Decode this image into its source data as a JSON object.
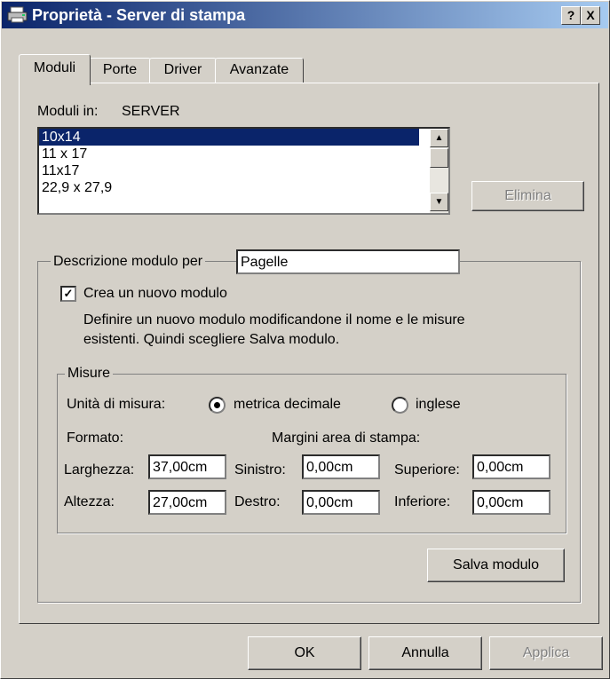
{
  "window": {
    "title": "Proprietà - Server di stampa",
    "help_button": "?",
    "close_button": "X",
    "icon": "printer-icon"
  },
  "tabs": [
    {
      "label": "Moduli",
      "active": true
    },
    {
      "label": "Porte",
      "active": false
    },
    {
      "label": "Driver",
      "active": false
    },
    {
      "label": "Avanzate",
      "active": false
    }
  ],
  "moduli": {
    "moduli_in_label": "Moduli in:",
    "server_name": "SERVER",
    "forms": [
      "10x14",
      "11 x 17",
      "11x17",
      "22,9 x 27,9"
    ],
    "selected_form": "10x14",
    "delete_button": "Elimina"
  },
  "description": {
    "label": "Descrizione modulo per",
    "value": "Pagelle",
    "create_checkbox_label": "Crea un nuovo modulo",
    "create_checked": true,
    "help_text_line1": "Definire un nuovo modulo modificandone il nome e le misure",
    "help_text_line2": "esistenti. Quindi scegliere Salva modulo."
  },
  "measures": {
    "group_label": "Misure",
    "units_label": "Unità di misura:",
    "unit_metric": "metrica decimale",
    "unit_english": "inglese",
    "selected_unit": "metrica decimale",
    "format_label": "Formato:",
    "margins_label": "Margini area di stampa:",
    "width_label": "Larghezza:",
    "width_value": "37,00cm",
    "height_label": "Altezza:",
    "height_value": "27,00cm",
    "left_label": "Sinistro:",
    "left_value": "0,00cm",
    "right_label": "Destro:",
    "right_value": "0,00cm",
    "top_label": "Superiore:",
    "top_value": "0,00cm",
    "bottom_label": "Inferiore:",
    "bottom_value": "0,00cm",
    "save_button": "Salva modulo"
  },
  "footer": {
    "ok": "OK",
    "cancel": "Annulla",
    "apply": "Applica"
  }
}
